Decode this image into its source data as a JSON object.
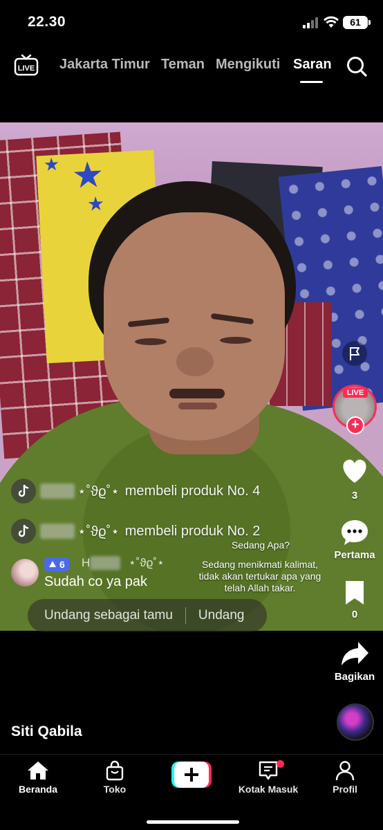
{
  "status_bar": {
    "time": "22.30",
    "battery": "61"
  },
  "top_nav": {
    "live_label": "LIVE",
    "tabs": [
      {
        "label": "Jakarta Timur",
        "active": false
      },
      {
        "label": "Teman",
        "active": false
      },
      {
        "label": "Mengikuti",
        "active": false
      },
      {
        "label": "Saran",
        "active": true
      }
    ]
  },
  "chat": {
    "messages": [
      {
        "user_suffix": "⋆˚ϑϱ˚⋆",
        "text": "membeli produk No. 4"
      },
      {
        "user_suffix": "⋆˚ϑϱ˚⋆",
        "text": "membeli produk No. 2"
      },
      {
        "level": "6",
        "user_prefix": "H",
        "user_suffix": "⋆˚ϑϱ˚⋆",
        "text": "Sudah co ya pak"
      }
    ],
    "caption_title": "Sedang Apa?",
    "caption_body": "Sedang menikmati kalimat, tidak akan tertukar apa yang telah Allah takar."
  },
  "invite": {
    "guest_label": "Undang sebagai tamu",
    "invite_label": "Undang"
  },
  "rail": {
    "live_badge": "LIVE",
    "likes": "3",
    "comments_label": "Pertama",
    "bookmarks": "0",
    "share_label": "Bagikan"
  },
  "author": {
    "name": "Siti Qabila"
  },
  "bottom_nav": {
    "items": [
      {
        "label": "Beranda"
      },
      {
        "label": "Toko"
      },
      {
        "label": "Kotak Masuk"
      },
      {
        "label": "Profil"
      }
    ]
  },
  "colors": {
    "accent": "#fe2c55",
    "cyan": "#25f4ee",
    "background": "#000000"
  }
}
